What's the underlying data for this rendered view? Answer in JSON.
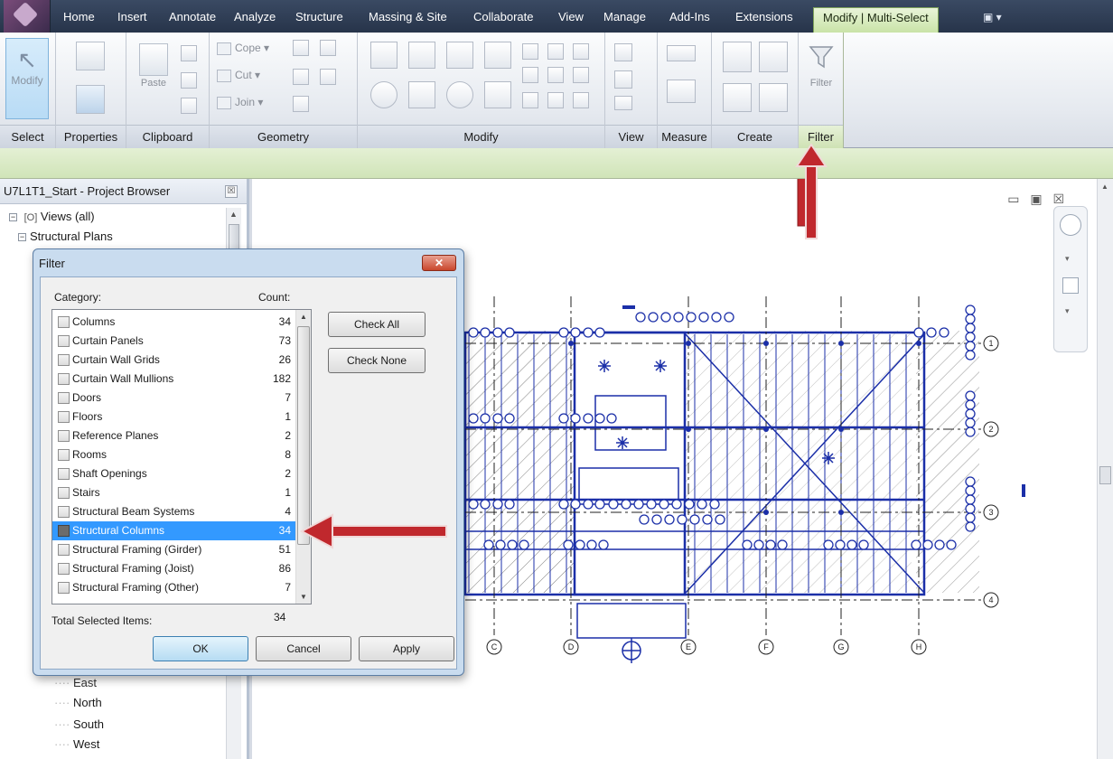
{
  "ribbon": {
    "tabs": [
      {
        "label": "Home",
        "left": 0
      },
      {
        "label": "Insert"
      },
      {
        "label": "Annotate"
      },
      {
        "label": "Analyze"
      },
      {
        "label": "Structure"
      },
      {
        "label": "Massing & Site"
      },
      {
        "label": "Collaborate"
      },
      {
        "label": "View"
      },
      {
        "label": "Manage"
      },
      {
        "label": "Add-Ins"
      },
      {
        "label": "Extensions"
      }
    ],
    "active_tab": "Modify | Multi-Select",
    "panels": {
      "select": "Select",
      "properties": "Properties",
      "clipboard": "Clipboard",
      "geometry": "Geometry",
      "modify": "Modify",
      "view": "View",
      "measure": "Measure",
      "create": "Create",
      "filter": "Filter"
    },
    "tools": {
      "modify": "Modify",
      "paste": "Paste",
      "cope": "Cope",
      "cut": "Cut",
      "join": "Join",
      "filter": "Filter"
    }
  },
  "browser": {
    "title": "U7L1T1_Start - Project Browser",
    "nodes": {
      "views": "Views (all)",
      "structural_plans": "Structural Plans",
      "east": "East",
      "north": "North",
      "south": "South",
      "west": "West"
    }
  },
  "filter_dialog": {
    "title": "Filter",
    "category_label": "Category:",
    "count_label": "Count:",
    "categories": [
      {
        "name": "Columns",
        "count": "34",
        "checked": false
      },
      {
        "name": "Curtain Panels",
        "count": "73",
        "checked": false
      },
      {
        "name": "Curtain Wall Grids",
        "count": "26",
        "checked": false
      },
      {
        "name": "Curtain Wall Mullions",
        "count": "182",
        "checked": false
      },
      {
        "name": "Doors",
        "count": "7",
        "checked": false
      },
      {
        "name": "Floors",
        "count": "1",
        "checked": false
      },
      {
        "name": "Reference Planes",
        "count": "2",
        "checked": false
      },
      {
        "name": "Rooms",
        "count": "8",
        "checked": false
      },
      {
        "name": "Shaft Openings",
        "count": "2",
        "checked": false
      },
      {
        "name": "Stairs",
        "count": "1",
        "checked": false
      },
      {
        "name": "Structural Beam Systems",
        "count": "4",
        "checked": false
      },
      {
        "name": "Structural Columns",
        "count": "34",
        "checked": true
      },
      {
        "name": "Structural Framing (Girder)",
        "count": "51",
        "checked": false
      },
      {
        "name": "Structural Framing (Joist)",
        "count": "86",
        "checked": false
      },
      {
        "name": "Structural Framing (Other)",
        "count": "7",
        "checked": false
      }
    ],
    "check_all": "Check All",
    "check_none": "Check None",
    "total_label": "Total Selected Items:",
    "total_value": "34",
    "ok": "OK",
    "cancel": "Cancel",
    "apply": "Apply"
  },
  "drawing": {
    "grid_numbers": [
      "1",
      "2",
      "3",
      "4"
    ],
    "grid_letters": [
      "C",
      "D",
      "E",
      "F",
      "G",
      "H"
    ]
  },
  "colors": {
    "ribbon_dark": "#27344a",
    "contextual_tab": "#c9e3a7",
    "selection_blue": "#3399ff",
    "drawing_blue": "#1b2fa8",
    "annotation_red": "#c0282d"
  }
}
